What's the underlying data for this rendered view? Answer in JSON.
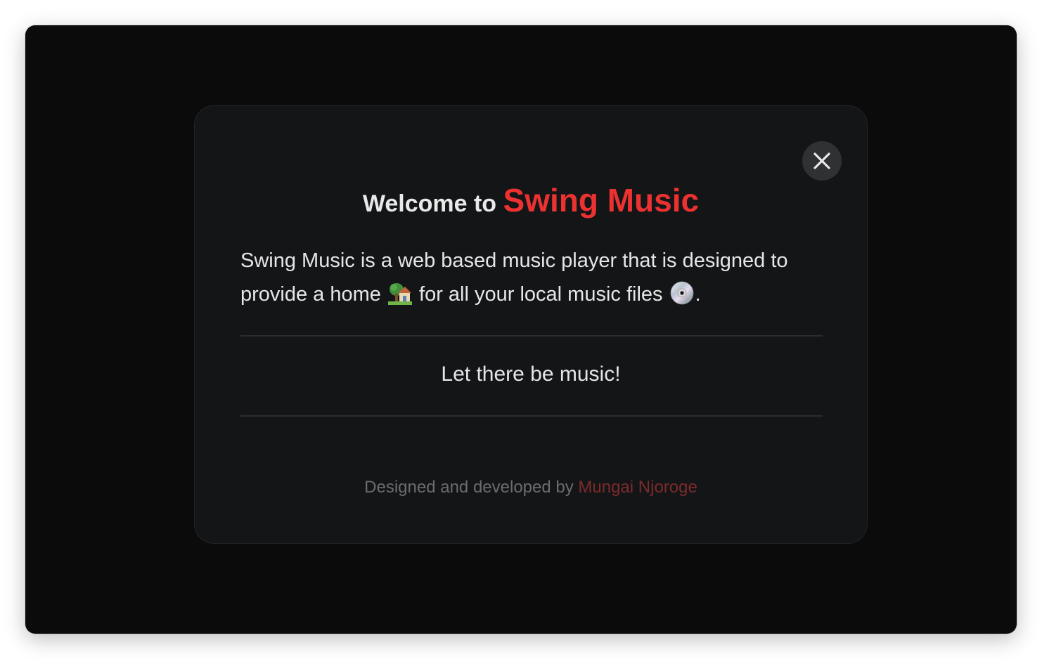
{
  "modal": {
    "title_prefix": "Welcome to",
    "title_brand": "Swing Music",
    "description_part1": "Swing Music is a web based music player that is designed to provide a home",
    "description_part2": "for all your local music files",
    "description_end": ".",
    "home_icon": "house-with-garden-icon",
    "disc_icon": "dvd-disc-icon",
    "tagline": "Let there be music!",
    "credits_prefix": "Designed and developed by",
    "credits_author": "Mungai Njoroge",
    "close_icon": "close-icon"
  },
  "colors": {
    "window_background": "#0b0b0c",
    "modal_background": "#141517",
    "brand_red": "#ec3131",
    "author_red": "#7c2b2b",
    "close_button_bg": "#303133"
  }
}
